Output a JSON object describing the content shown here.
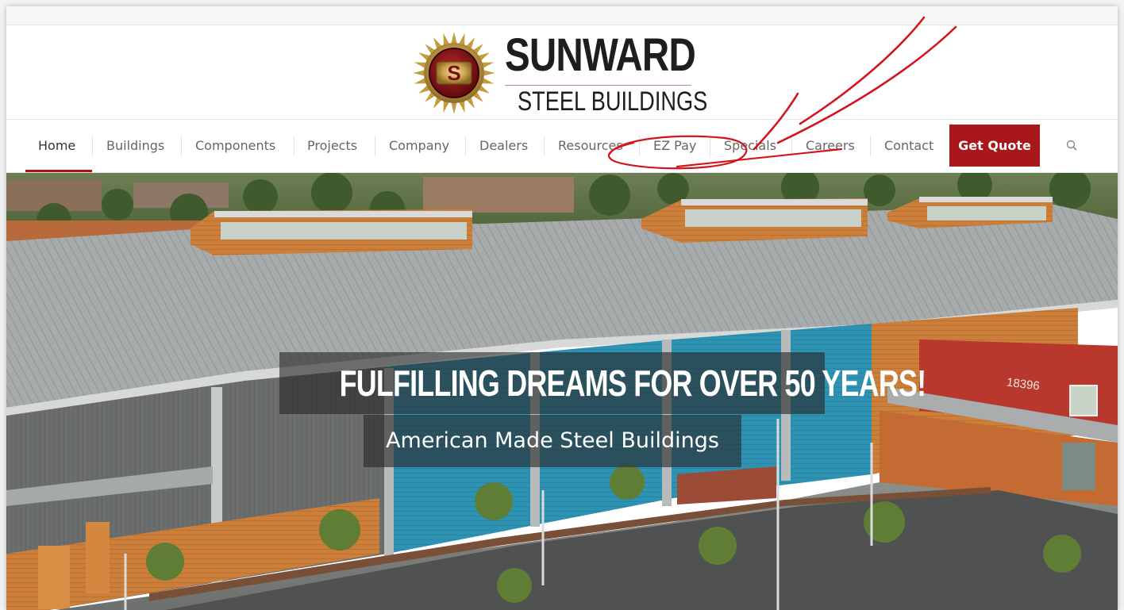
{
  "brand": {
    "name_top": "SUNWARD",
    "name_bottom": "STEEL BUILDINGS",
    "badge_letter": "S"
  },
  "nav": {
    "items": [
      {
        "label": "Home",
        "active": true
      },
      {
        "label": "Buildings"
      },
      {
        "label": "Components"
      },
      {
        "label": "Projects"
      },
      {
        "label": "Company"
      },
      {
        "label": "Dealers"
      },
      {
        "label": "Resources"
      },
      {
        "label": "EZ Pay"
      },
      {
        "label": "Specials"
      },
      {
        "label": "Careers"
      },
      {
        "label": "Contact"
      }
    ],
    "cta_label": "Get Quote",
    "search_icon": "search-icon"
  },
  "hero": {
    "headline": "FULFILLING DREAMS FOR OVER 50 YEARS!",
    "subheadline": "American Made Steel Buildings",
    "building_number": "18396"
  },
  "colors": {
    "accent_red": "#a8181a",
    "annotation_red": "#d4141c",
    "nav_text": "#666666"
  }
}
